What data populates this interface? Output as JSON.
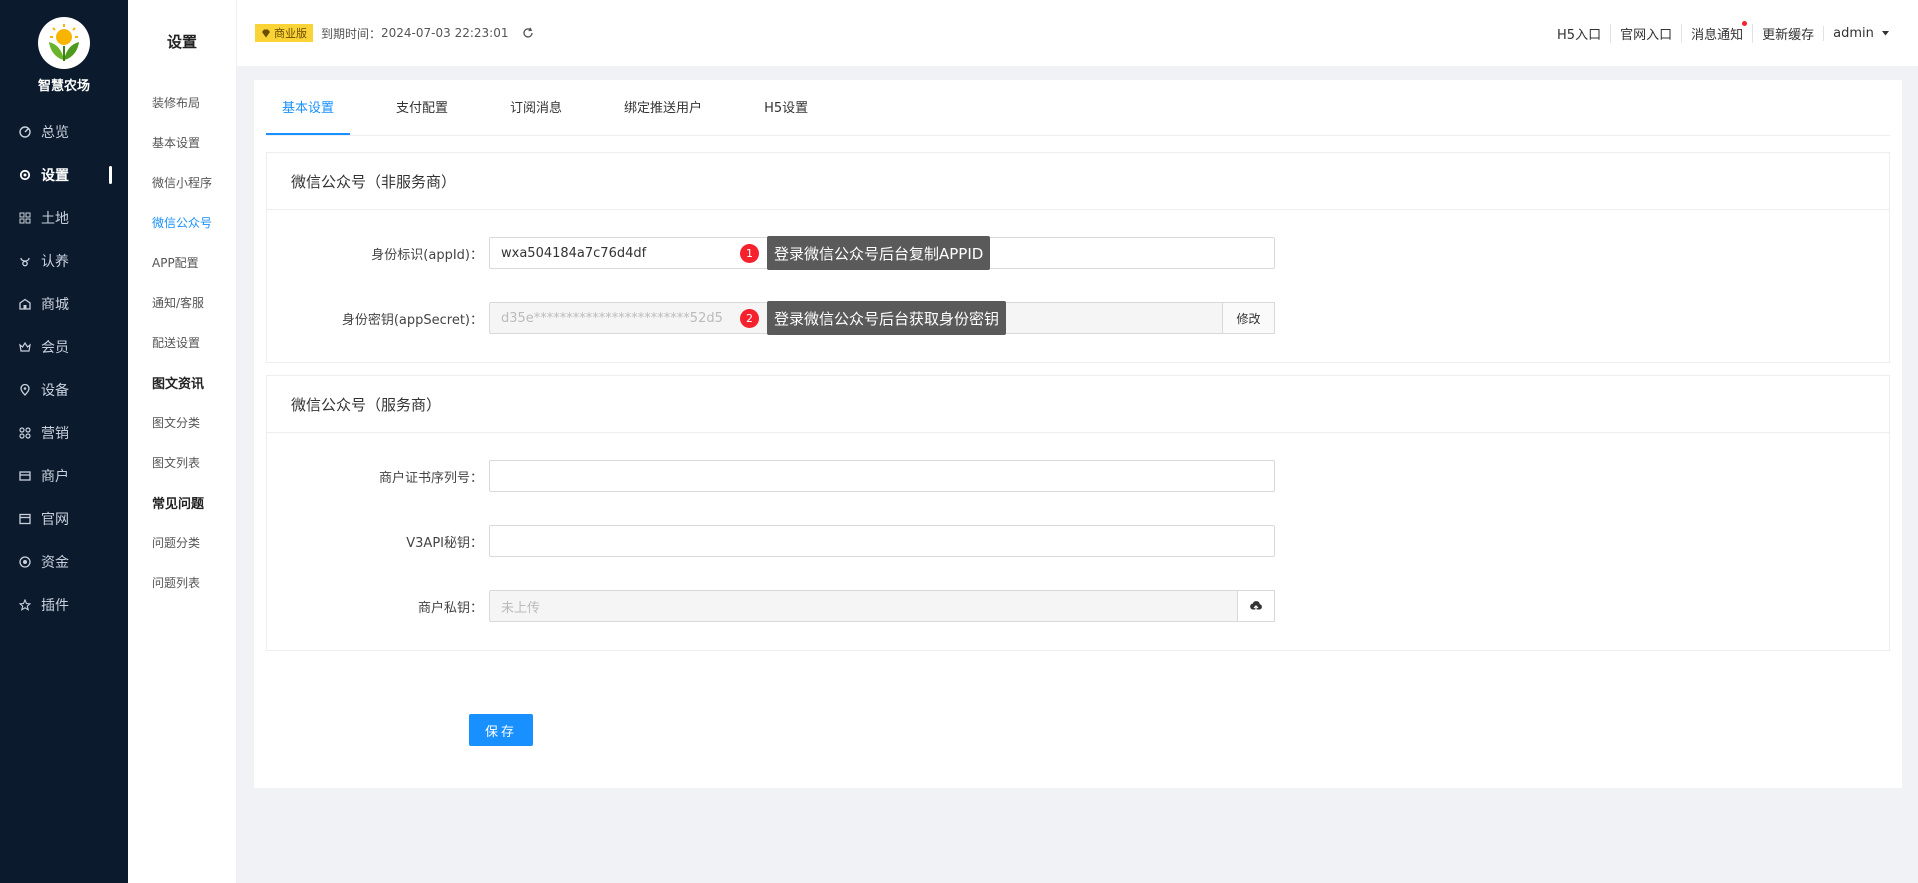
{
  "app": {
    "name": "智慧农场"
  },
  "sidebar": {
    "items": [
      {
        "label": "总览",
        "icon": "overview-icon"
      },
      {
        "label": "设置",
        "icon": "settings-icon",
        "active": true
      },
      {
        "label": "土地",
        "icon": "land-icon"
      },
      {
        "label": "认养",
        "icon": "adopt-icon"
      },
      {
        "label": "商城",
        "icon": "shop-icon"
      },
      {
        "label": "会员",
        "icon": "member-icon"
      },
      {
        "label": "设备",
        "icon": "device-icon"
      },
      {
        "label": "营销",
        "icon": "marketing-icon"
      },
      {
        "label": "商户",
        "icon": "merchant-icon"
      },
      {
        "label": "官网",
        "icon": "website-icon"
      },
      {
        "label": "资金",
        "icon": "funds-icon"
      },
      {
        "label": "插件",
        "icon": "plugin-icon"
      }
    ]
  },
  "submenu": {
    "title": "设置",
    "items": [
      {
        "label": "装修布局"
      },
      {
        "label": "基本设置"
      },
      {
        "label": "微信小程序"
      },
      {
        "label": "微信公众号",
        "active": true
      },
      {
        "label": "APP配置"
      },
      {
        "label": "通知/客服"
      },
      {
        "label": "配送设置"
      },
      {
        "label": "图文资讯",
        "group": true
      },
      {
        "label": "图文分类"
      },
      {
        "label": "图文列表"
      },
      {
        "label": "常见问题",
        "group": true
      },
      {
        "label": "问题分类"
      },
      {
        "label": "问题列表"
      }
    ]
  },
  "header": {
    "badge": "商业版",
    "expiry_label": "到期时间：",
    "expiry_value": "2024-07-03 22:23:01",
    "links": [
      "H5入口",
      "官网入口",
      "消息通知",
      "更新缓存"
    ],
    "user": "admin"
  },
  "tabs": [
    {
      "label": "基本设置",
      "active": true
    },
    {
      "label": "支付配置"
    },
    {
      "label": "订阅消息"
    },
    {
      "label": "绑定推送用户"
    },
    {
      "label": "H5设置"
    }
  ],
  "card1": {
    "title": "微信公众号（非服务商）",
    "appid_label": "身份标识(appId)：",
    "appid_value": "wxa504184a7c76d4df",
    "secret_label": "身份密钥(appSecret)：",
    "secret_value": "d35e************************52d5",
    "modify_label": "修改",
    "tip1_num": "1",
    "tip1_text": "登录微信公众号后台复制APPID",
    "tip2_num": "2",
    "tip2_text": "登录微信公众号后台获取身份密钥"
  },
  "card2": {
    "title": "微信公众号（服务商）",
    "serial_label": "商户证书序列号：",
    "serial_value": "",
    "v3_label": "V3API秘钥：",
    "v3_value": "",
    "privkey_label": "商户私钥：",
    "privkey_placeholder": "未上传"
  },
  "save_label": "保存",
  "colors": {
    "sidebar_bg": "#0b1a2d",
    "accent": "#1890ff",
    "badge": "#fad337",
    "tip_badge": "#f5222d"
  }
}
